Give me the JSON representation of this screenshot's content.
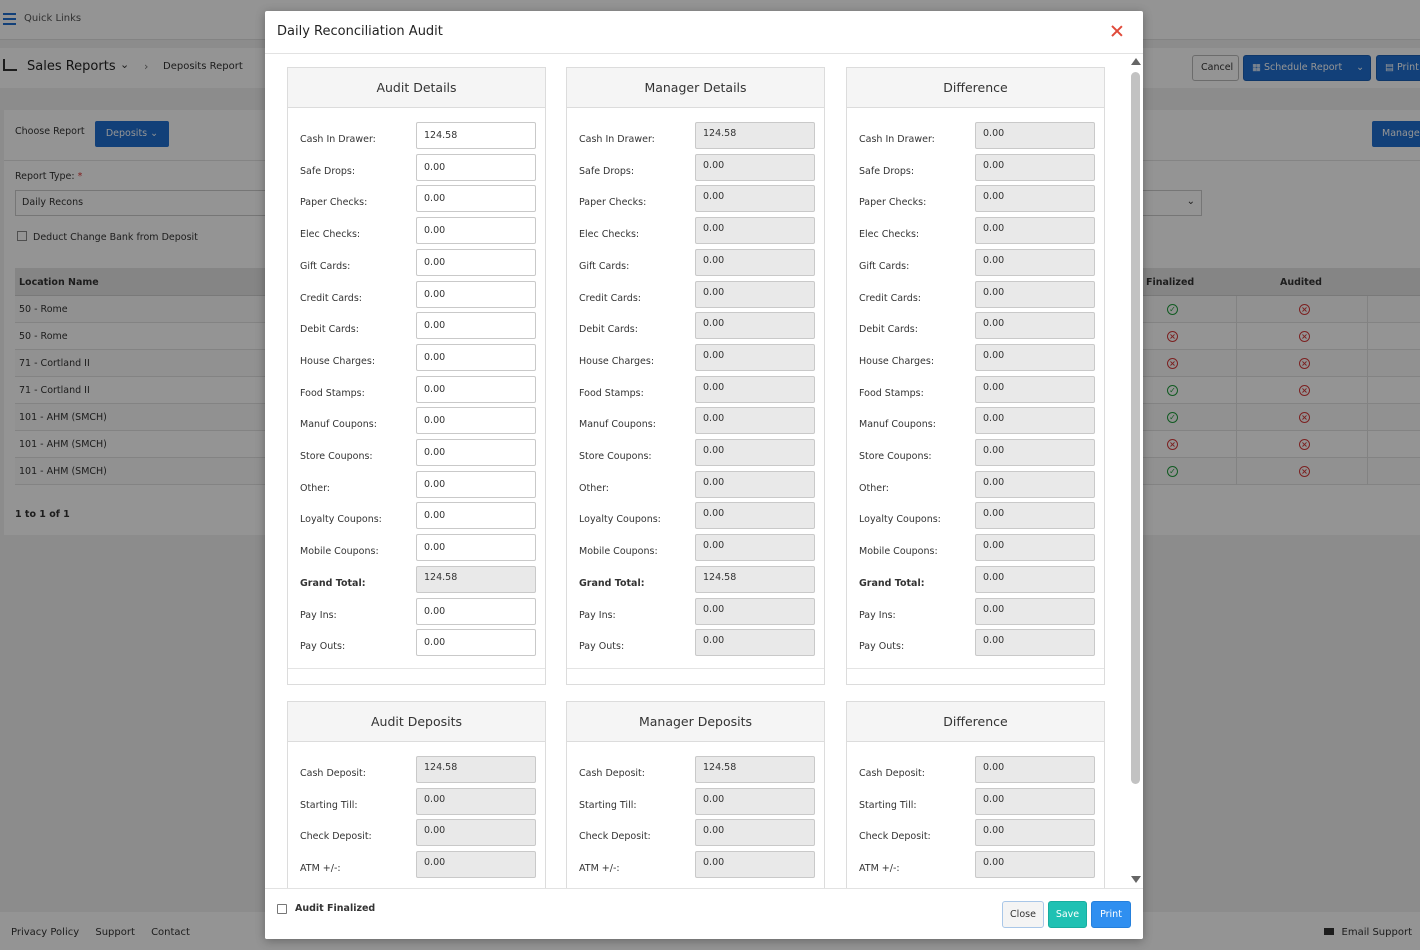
{
  "background": {
    "quick_links": "Quick Links",
    "sales_reports": "Sales Reports",
    "breadcrumb": "Deposits Report",
    "cancel": "Cancel",
    "schedule_report": "Schedule Report",
    "print": "Print",
    "choose_report": "Choose Report",
    "deposits_btn": "Deposits",
    "manage": "Manage",
    "report_type_label": "Report Type:",
    "report_type_value": "Daily Recons",
    "deduct_label": "Deduct Change Bank from Deposit",
    "table": {
      "col_location": "Location Name",
      "col_finalized": "Finalized",
      "col_audited": "Audited",
      "rows": [
        {
          "location": "50 - Rome",
          "finalized": true,
          "audited": false
        },
        {
          "location": "50 - Rome",
          "finalized": false,
          "audited": false
        },
        {
          "location": "71 - Cortland II",
          "finalized": false,
          "audited": false
        },
        {
          "location": "71 - Cortland II",
          "finalized": true,
          "audited": false
        },
        {
          "location": "101 - AHM (SMCH)",
          "finalized": true,
          "audited": false
        },
        {
          "location": "101 - AHM (SMCH)",
          "finalized": false,
          "audited": false
        },
        {
          "location": "101 - AHM (SMCH)",
          "finalized": true,
          "audited": false
        }
      ]
    },
    "pager": "1 to 1 of 1",
    "footer": {
      "privacy": "Privacy Policy",
      "support": "Support",
      "contact": "Contact",
      "email_support": "Email Support"
    },
    "colors": {
      "primary": "#1f6fd1",
      "ok": "#1f9d3c",
      "bad": "#d63a3a"
    }
  },
  "modal": {
    "title": "Daily Reconciliation Audit",
    "sections": {
      "audit_details": {
        "title": "Audit Details",
        "fields": [
          {
            "label": "Cash In Drawer:",
            "value": "124.58",
            "readonly": false
          },
          {
            "label": "Safe Drops:",
            "value": "0.00",
            "readonly": false
          },
          {
            "label": "Paper Checks:",
            "value": "0.00",
            "readonly": false
          },
          {
            "label": "Elec Checks:",
            "value": "0.00",
            "readonly": false
          },
          {
            "label": "Gift Cards:",
            "value": "0.00",
            "readonly": false
          },
          {
            "label": "Credit Cards:",
            "value": "0.00",
            "readonly": false
          },
          {
            "label": "Debit Cards:",
            "value": "0.00",
            "readonly": false
          },
          {
            "label": "House Charges:",
            "value": "0.00",
            "readonly": false
          },
          {
            "label": "Food Stamps:",
            "value": "0.00",
            "readonly": false
          },
          {
            "label": "Manuf Coupons:",
            "value": "0.00",
            "readonly": false
          },
          {
            "label": "Store Coupons:",
            "value": "0.00",
            "readonly": false
          },
          {
            "label": "Other:",
            "value": "0.00",
            "readonly": false
          },
          {
            "label": "Loyalty Coupons:",
            "value": "0.00",
            "readonly": false
          },
          {
            "label": "Mobile Coupons:",
            "value": "0.00",
            "readonly": false
          },
          {
            "label": "Grand Total:",
            "value": "124.58",
            "readonly": true,
            "bold": true
          },
          {
            "label": "Pay Ins:",
            "value": "0.00",
            "readonly": false
          },
          {
            "label": "Pay Outs:",
            "value": "0.00",
            "readonly": false
          }
        ]
      },
      "manager_details": {
        "title": "Manager Details",
        "fields": [
          {
            "label": "Cash In Drawer:",
            "value": "124.58"
          },
          {
            "label": "Safe Drops:",
            "value": "0.00"
          },
          {
            "label": "Paper Checks:",
            "value": "0.00"
          },
          {
            "label": "Elec Checks:",
            "value": "0.00"
          },
          {
            "label": "Gift Cards:",
            "value": "0.00"
          },
          {
            "label": "Credit Cards:",
            "value": "0.00"
          },
          {
            "label": "Debit Cards:",
            "value": "0.00"
          },
          {
            "label": "House Charges:",
            "value": "0.00"
          },
          {
            "label": "Food Stamps:",
            "value": "0.00"
          },
          {
            "label": "Manuf Coupons:",
            "value": "0.00"
          },
          {
            "label": "Store Coupons:",
            "value": "0.00"
          },
          {
            "label": "Other:",
            "value": "0.00"
          },
          {
            "label": "Loyalty Coupons:",
            "value": "0.00"
          },
          {
            "label": "Mobile Coupons:",
            "value": "0.00"
          },
          {
            "label": "Grand Total:",
            "value": "124.58",
            "bold": true
          },
          {
            "label": "Pay Ins:",
            "value": "0.00"
          },
          {
            "label": "Pay Outs:",
            "value": "0.00"
          }
        ]
      },
      "difference_details": {
        "title": "Difference",
        "fields": [
          {
            "label": "Cash In Drawer:",
            "value": "0.00"
          },
          {
            "label": "Safe Drops:",
            "value": "0.00"
          },
          {
            "label": "Paper Checks:",
            "value": "0.00"
          },
          {
            "label": "Elec Checks:",
            "value": "0.00"
          },
          {
            "label": "Gift Cards:",
            "value": "0.00"
          },
          {
            "label": "Credit Cards:",
            "value": "0.00"
          },
          {
            "label": "Debit Cards:",
            "value": "0.00"
          },
          {
            "label": "House Charges:",
            "value": "0.00"
          },
          {
            "label": "Food Stamps:",
            "value": "0.00"
          },
          {
            "label": "Manuf Coupons:",
            "value": "0.00"
          },
          {
            "label": "Store Coupons:",
            "value": "0.00"
          },
          {
            "label": "Other:",
            "value": "0.00"
          },
          {
            "label": "Loyalty Coupons:",
            "value": "0.00"
          },
          {
            "label": "Mobile Coupons:",
            "value": "0.00"
          },
          {
            "label": "Grand Total:",
            "value": "0.00",
            "bold": true
          },
          {
            "label": "Pay Ins:",
            "value": "0.00"
          },
          {
            "label": "Pay Outs:",
            "value": "0.00"
          }
        ]
      },
      "audit_deposits": {
        "title": "Audit Deposits",
        "fields": [
          {
            "label": "Cash Deposit:",
            "value": "124.58"
          },
          {
            "label": "Starting Till:",
            "value": "0.00"
          },
          {
            "label": "Check Deposit:",
            "value": "0.00"
          },
          {
            "label": "ATM +/-:",
            "value": "0.00"
          }
        ]
      },
      "manager_deposits": {
        "title": "Manager Deposits",
        "fields": [
          {
            "label": "Cash Deposit:",
            "value": "124.58"
          },
          {
            "label": "Starting Till:",
            "value": "0.00"
          },
          {
            "label": "Check Deposit:",
            "value": "0.00"
          },
          {
            "label": "ATM +/-:",
            "value": "0.00"
          }
        ]
      },
      "difference_deposits": {
        "title": "Difference",
        "fields": [
          {
            "label": "Cash Deposit:",
            "value": "0.00"
          },
          {
            "label": "Starting Till:",
            "value": "0.00"
          },
          {
            "label": "Check Deposit:",
            "value": "0.00"
          },
          {
            "label": "ATM +/-:",
            "value": "0.00"
          }
        ]
      }
    },
    "audit_finalized_label": "Audit Finalized",
    "buttons": {
      "close": "Close",
      "save": "Save",
      "print": "Print"
    },
    "colors": {
      "close_x": "#e04a3a",
      "save": "#1fc1b3",
      "print": "#2f8ff0"
    }
  }
}
